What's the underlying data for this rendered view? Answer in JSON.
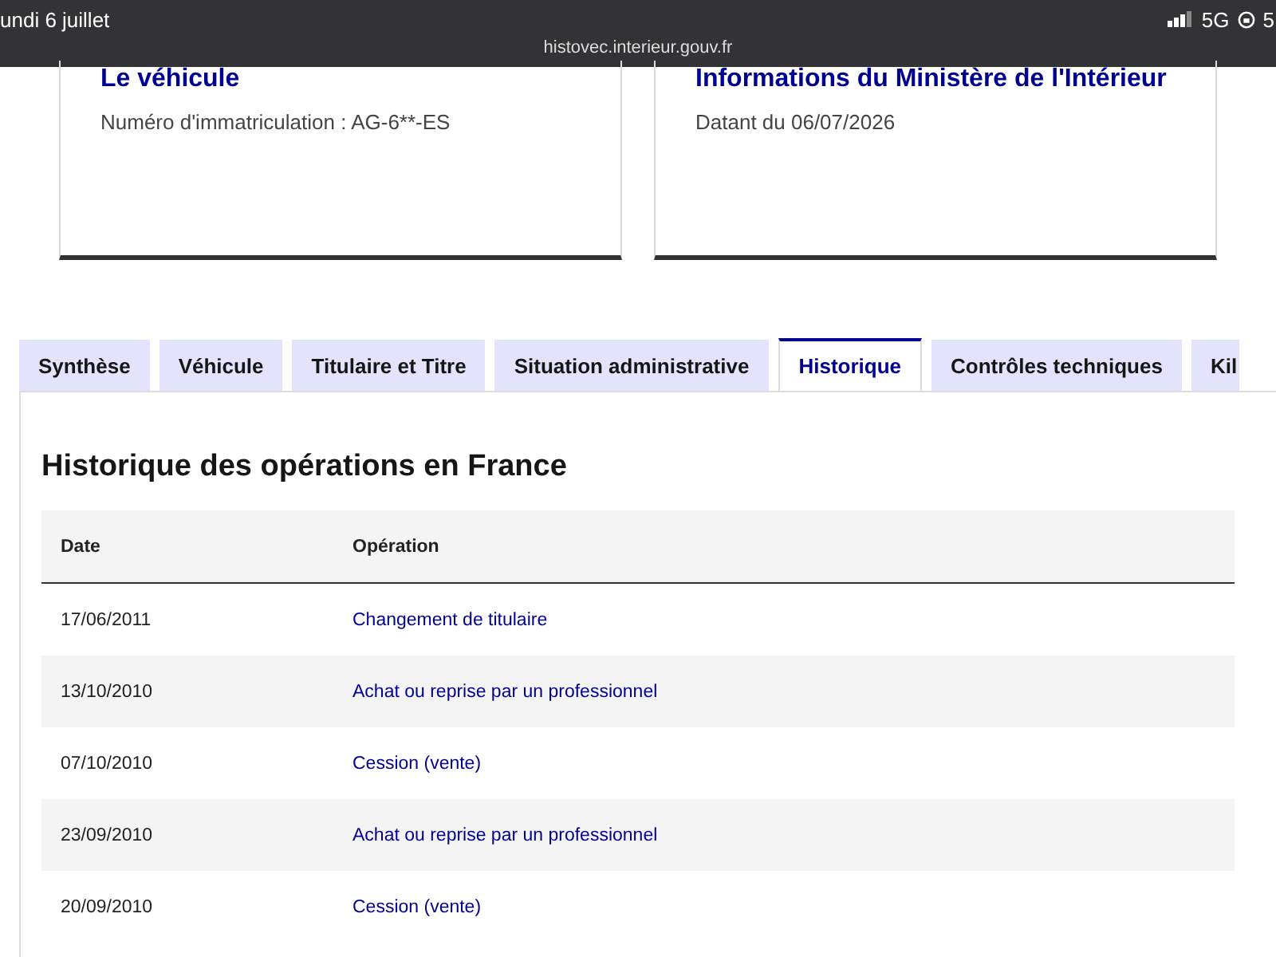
{
  "status_bar": {
    "date": "undi 6 juillet",
    "network": "5G",
    "battery": "5"
  },
  "address_bar": {
    "url": "histovec.interieur.gouv.fr"
  },
  "cards": [
    {
      "title": "Le véhicule",
      "text": "Numéro d'immatriculation : AG-6**-ES"
    },
    {
      "title": "Informations du Ministère de l'Intérieur",
      "text": "Datant du 06/07/2026"
    }
  ],
  "tabs": [
    {
      "label": "Synthèse",
      "selected": false
    },
    {
      "label": "Véhicule",
      "selected": false
    },
    {
      "label": "Titulaire et Titre",
      "selected": false
    },
    {
      "label": "Situation administrative",
      "selected": false
    },
    {
      "label": "Historique",
      "selected": true
    },
    {
      "label": "Contrôles techniques",
      "selected": false
    },
    {
      "label": "Kil",
      "selected": false
    }
  ],
  "section": {
    "title": "Historique des opérations en France"
  },
  "table": {
    "columns": [
      "Date",
      "Opération"
    ],
    "rows": [
      [
        "17/06/2011",
        "Changement de titulaire"
      ],
      [
        "13/10/2010",
        "Achat ou reprise par un professionnel"
      ],
      [
        "07/10/2010",
        "Cession (vente)"
      ],
      [
        "23/09/2010",
        "Achat ou reprise par un professionnel"
      ],
      [
        "20/09/2010",
        "Cession (vente)"
      ]
    ]
  }
}
